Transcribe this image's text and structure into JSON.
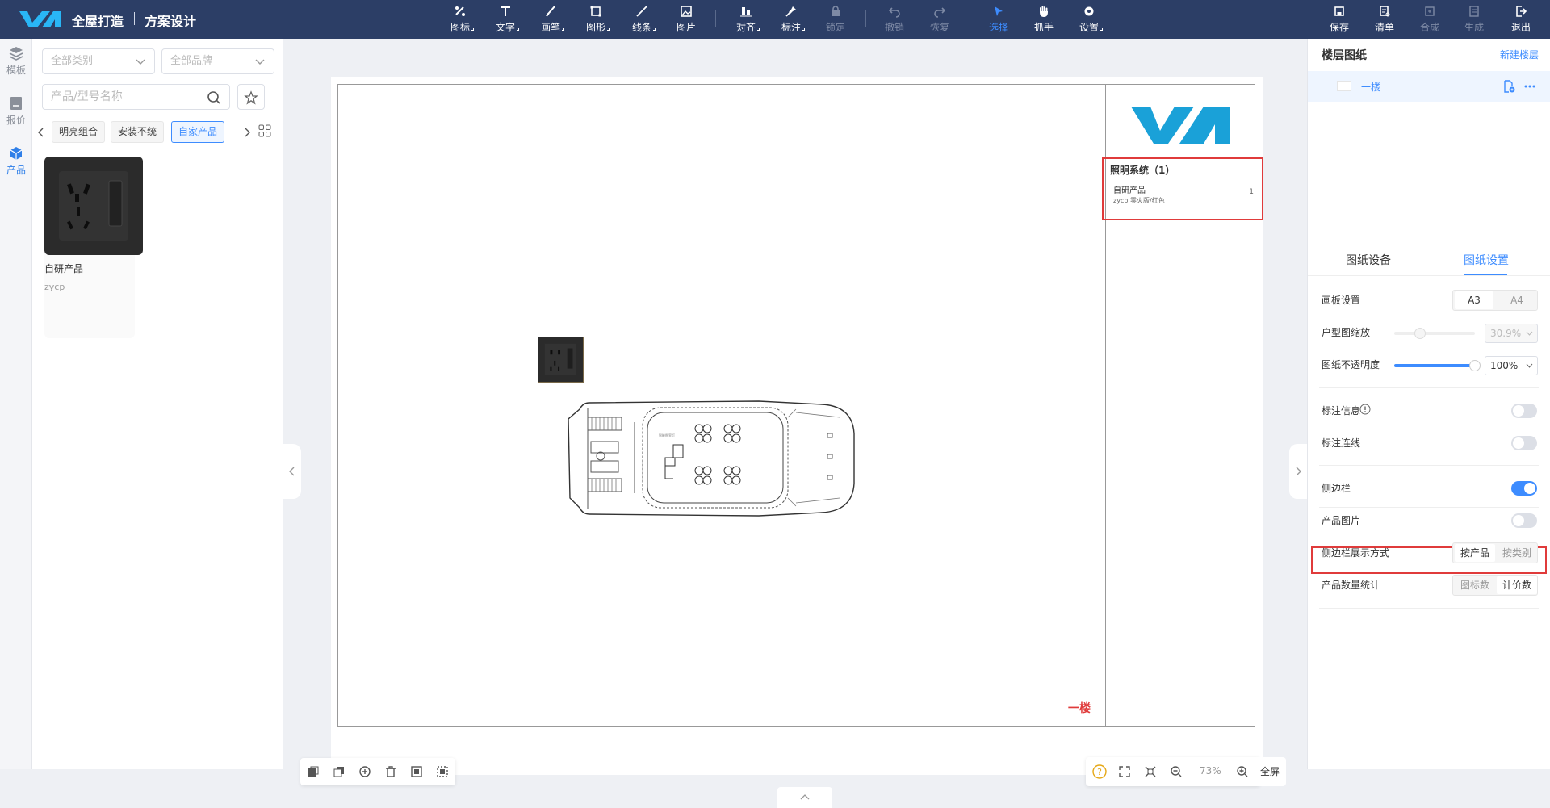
{
  "app": {
    "title": "全屋打造",
    "page_title": "方案设计"
  },
  "toolbar": {
    "tools": [
      {
        "label": "图标",
        "icon": "icon-tool-icon"
      },
      {
        "label": "文字",
        "icon": "text-icon"
      },
      {
        "label": "画笔",
        "icon": "brush-icon"
      },
      {
        "label": "图形",
        "icon": "shape-icon"
      },
      {
        "label": "线条",
        "icon": "line-icon"
      },
      {
        "label": "图片",
        "icon": "image-icon"
      },
      {
        "label": "对齐",
        "icon": "align-icon"
      },
      {
        "label": "标注",
        "icon": "pin-icon"
      },
      {
        "label": "锁定",
        "icon": "lock-icon"
      },
      {
        "label": "撤销",
        "icon": "undo-icon"
      },
      {
        "label": "恢复",
        "icon": "redo-icon"
      },
      {
        "label": "选择",
        "icon": "cursor-icon"
      },
      {
        "label": "抓手",
        "icon": "hand-icon"
      },
      {
        "label": "设置",
        "icon": "gear-icon"
      }
    ],
    "actions": [
      {
        "label": "保存",
        "icon": "save-icon"
      },
      {
        "label": "清单",
        "icon": "list-icon"
      },
      {
        "label": "合成",
        "icon": "compose-icon"
      },
      {
        "label": "生成",
        "icon": "generate-icon"
      },
      {
        "label": "退出",
        "icon": "exit-icon"
      }
    ],
    "active_color": "#3d8cff"
  },
  "leftrail": [
    {
      "label": "模板",
      "icon": "layers-icon"
    },
    {
      "label": "报价",
      "icon": "quote-icon"
    },
    {
      "label": "产品",
      "icon": "cube-icon"
    }
  ],
  "panel": {
    "category_placeholder": "全部类别",
    "brand_placeholder": "全部品牌",
    "search_placeholder": "产品/型号名称",
    "chips": [
      "明亮组合",
      "安装不统",
      "自家产品"
    ],
    "product": {
      "name": "自研产品",
      "code": "zycp"
    }
  },
  "sheet": {
    "legend": {
      "title": "照明系统（1）",
      "item": "自研产品",
      "spec": "zycp 零火版/红色",
      "count": "1"
    },
    "floor_tag": "一楼",
    "floorplan_caption": "智能卧室灯"
  },
  "zoom": {
    "level": "73%",
    "fullscreen": "全屏"
  },
  "rpanel": {
    "floors_title": "楼层图纸",
    "new_floor": "新建楼层",
    "floor_name": "一楼",
    "tabs": [
      "图纸设备",
      "图纸设置"
    ],
    "board": {
      "label": "画板设置",
      "options": [
        "A3",
        "A4"
      ],
      "selected": "A3"
    },
    "plan_scale": {
      "label": "户型图缩放",
      "value": "30.9%"
    },
    "opacity": {
      "label": "图纸不透明度",
      "value": "100%",
      "fill": 1.0
    },
    "annotation_info": {
      "label": "标注信息",
      "on": false
    },
    "annotation_line": {
      "label": "标注连线",
      "on": false
    },
    "sidebar": {
      "label": "侧边栏",
      "on": true
    },
    "product_image": {
      "label": "产品图片",
      "on": false
    },
    "sidebar_mode": {
      "label": "侧边栏展示方式",
      "options": [
        "按产品",
        "按类别"
      ],
      "selected": "按产品"
    },
    "count_stat": {
      "label": "产品数量统计",
      "options": [
        "图标数",
        "计价数"
      ],
      "selected": "计价数"
    }
  },
  "colors": {
    "topbar": "#2c3e66",
    "accent": "#3d8cff",
    "highlight": "#e03b3b",
    "brand": "#1aa1d8"
  }
}
